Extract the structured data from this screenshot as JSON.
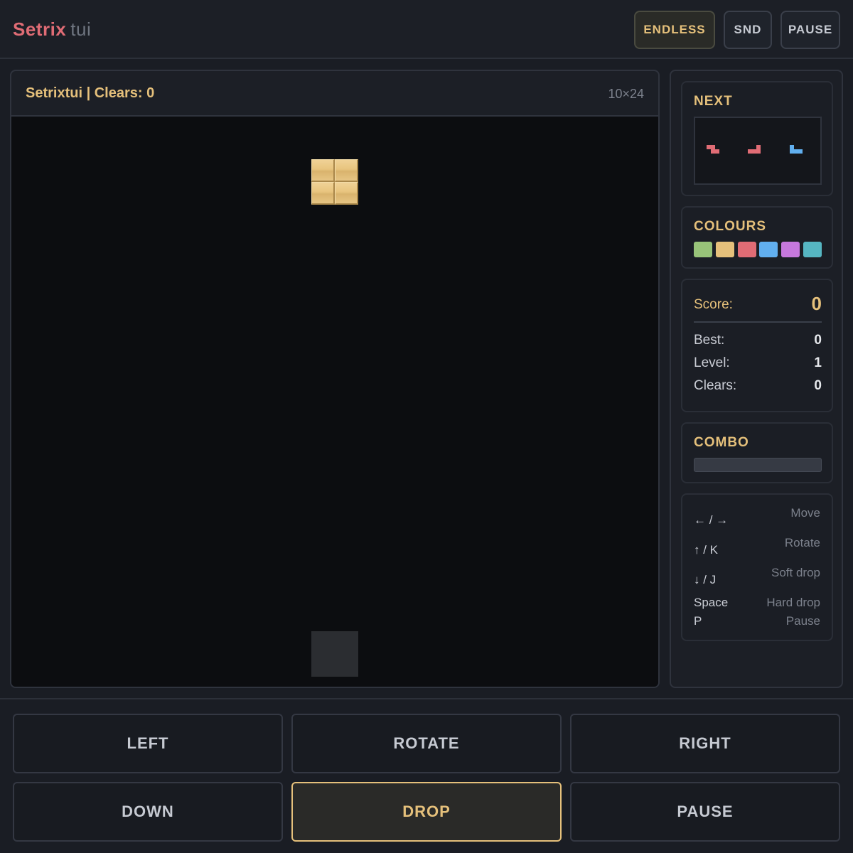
{
  "app": {
    "name": "Setrix",
    "suffix": "tui"
  },
  "header": {
    "mode_label": "ENDLESS",
    "sound_label": "SND",
    "pause_label": "PAUSE"
  },
  "board": {
    "title": "Setrixtui | Clears: 0",
    "dimensions": "10×24",
    "active_piece": {
      "type": "O",
      "color": "#e5c07b"
    },
    "ghost_color": "#2b2d31"
  },
  "next": {
    "title": "NEXT",
    "pieces": [
      {
        "type": "Z",
        "color": "#e06c75"
      },
      {
        "type": "L",
        "color": "#e06c75"
      },
      {
        "type": "J",
        "color": "#61afef"
      }
    ]
  },
  "colours": {
    "title": "COLOURS",
    "swatches": [
      "#98c379",
      "#e5c07b",
      "#e06c75",
      "#61afef",
      "#c678dd",
      "#56b6c2"
    ]
  },
  "stats": {
    "score_label": "Score:",
    "score": "0",
    "best_label": "Best:",
    "best": "0",
    "level_label": "Level:",
    "level": "1",
    "clears_label": "Clears:",
    "clears": "0"
  },
  "combo": {
    "title": "COMBO",
    "progress": 0
  },
  "help": {
    "rows": [
      {
        "key": "← / →",
        "action": "Move"
      },
      {
        "key": "↑ / K",
        "action": "Rotate"
      },
      {
        "key": "↓ / J",
        "action": "Soft drop"
      },
      {
        "key": "Space",
        "action": "Hard drop"
      },
      {
        "key": "P",
        "action": "Pause"
      }
    ]
  },
  "controls": {
    "left": "LEFT",
    "rotate": "ROTATE",
    "right": "RIGHT",
    "down": "DOWN",
    "drop": "DROP",
    "pause": "PAUSE"
  },
  "colors": {
    "accent": "#e5c07b",
    "brand": "#e06c75",
    "background": "#1a1d24",
    "board": "#0c0d10"
  }
}
